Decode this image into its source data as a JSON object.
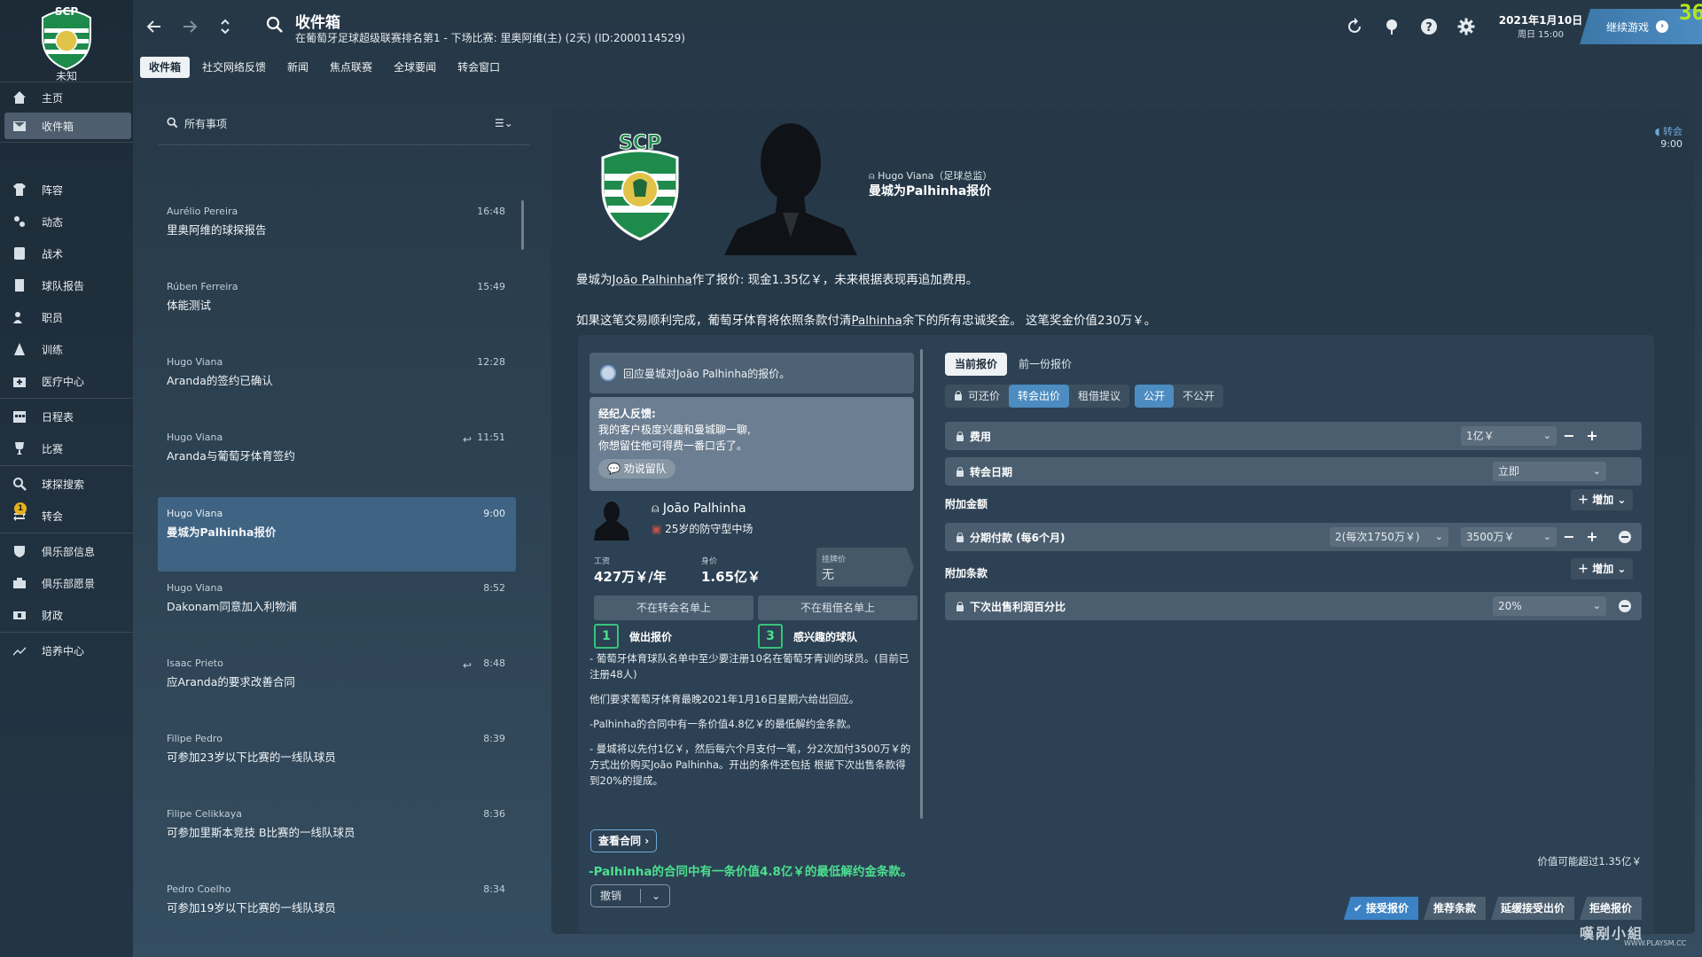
{
  "sidebar": {
    "club_name": "未知",
    "items": [
      {
        "label": "主页",
        "icon": "home-icon"
      },
      {
        "label": "收件箱",
        "icon": "inbox-icon",
        "active": true
      },
      {
        "label": "阵容",
        "icon": "shirt-icon"
      },
      {
        "label": "动态",
        "icon": "dynamics-icon"
      },
      {
        "label": "战术",
        "icon": "tactics-icon"
      },
      {
        "label": "球队报告",
        "icon": "report-icon"
      },
      {
        "label": "职员",
        "icon": "staff-icon"
      },
      {
        "label": "训练",
        "icon": "training-icon"
      },
      {
        "label": "医疗中心",
        "icon": "medical-icon"
      },
      {
        "label": "日程表",
        "icon": "calendar-icon"
      },
      {
        "label": "比赛",
        "icon": "trophy-icon"
      },
      {
        "label": "球探搜索",
        "icon": "scouting-icon"
      },
      {
        "label": "转会",
        "icon": "transfer-icon",
        "badge": "1"
      },
      {
        "label": "俱乐部信息",
        "icon": "shield-icon"
      },
      {
        "label": "俱乐部愿景",
        "icon": "vision-icon"
      },
      {
        "label": "财政",
        "icon": "finance-icon"
      },
      {
        "label": "培养中心",
        "icon": "development-icon"
      }
    ]
  },
  "header": {
    "title": "收件箱",
    "subtitle": "在葡萄牙足球超级联赛排名第1 - 下场比赛: 里奥阿维(主) (2天) (ID:2000114529)",
    "tabs": [
      "收件箱",
      "社交网络反馈",
      "新闻",
      "焦点联赛",
      "全球要闻",
      "转会窗口"
    ],
    "date_line1": "2021年1月10日",
    "date_line2": "周日 15:00",
    "continue_label": "继续游戏",
    "fps": "36"
  },
  "inbox": {
    "search_label": "所有事项",
    "messages": [
      {
        "sender": "Aurélio Pereira",
        "subject": "里奥阿维的球探报告",
        "time": "16:48"
      },
      {
        "sender": "Rúben Ferreira",
        "subject": "体能测试",
        "time": "15:49"
      },
      {
        "sender": "Hugo Viana",
        "subject": "Aranda的签约已确认",
        "time": "12:28"
      },
      {
        "sender": "Hugo Viana",
        "subject": "Aranda与葡萄牙体育签约",
        "time": "11:51",
        "replied": true
      },
      {
        "sender": "Hugo Viana",
        "subject": "曼城为Palhinha报价",
        "time": "9:00",
        "active": true
      },
      {
        "sender": "Hugo Viana",
        "subject": "Dakonam同意加入利物浦",
        "time": "8:52"
      },
      {
        "sender": "Isaac Prieto",
        "subject": "应Aranda的要求改善合同",
        "time": "8:48",
        "replied": true
      },
      {
        "sender": "Filipe Pedro",
        "subject": "可参加23岁以下比赛的一线队球员",
        "time": "8:39"
      },
      {
        "sender": "Filipe Celikkaya",
        "subject": "可参加里斯本竞技 B比赛的一线队球员",
        "time": "8:36"
      },
      {
        "sender": "Pedro Coelho",
        "subject": "可参加19岁以下比赛的一线队球员",
        "time": "8:34"
      }
    ]
  },
  "message": {
    "from": "Hugo Viana（足球总监）",
    "title": "曼城为Palhinha报价",
    "corner_tag": "转会",
    "corner_time": "9:00",
    "para1": {
      "a": "曼城为",
      "link": "João Palhinha",
      "b": "作了报价: 现金1.35亿￥，未来根据表现再追加费用。"
    },
    "para2": {
      "a": "如果这笔交易顺利完成，葡萄牙体育将依照条款付清",
      "link": "Palhinha",
      "b": "余下的所有忠诚奖金。 这笔奖金价值230万￥。"
    }
  },
  "deal": {
    "respond_label": "回应曼城对João Palhinha的报价。",
    "agent_label": "经纪人反馈:",
    "agent_line1": "我的客户极度兴趣和曼城聊一聊,",
    "agent_line2": "你想留住他可得费一番口舌了。",
    "persuade_label": "劝说留队",
    "player": {
      "name": "João Palhinha",
      "desc": "25岁的防守型中场",
      "wage_label": "工资",
      "wage": "427万￥/年",
      "value_label": "身价",
      "value": "1.65亿￥",
      "asking_label": "挂牌价",
      "asking": "无"
    },
    "not_transfer_list": "不在转会名单上",
    "not_loan_list": "不在租借名单上",
    "offers_count": "1",
    "offers_label": "做出报价",
    "interested_count": "3",
    "interested_label": "感兴趣的球队",
    "notes": [
      "- 葡萄牙体育球队名单中至少要注册10名在葡萄牙青训的球员。(目前已注册48人)",
      "他们要求葡萄牙体育最晚2021年1月16日星期六给出回应。",
      "-Palhinha的合同中有一条价值4.8亿￥的最低解约金条款。",
      "- 曼城将以先付1亿￥，然后每六个月支付一笔，分2次加付3500万￥的方式出价购买João Palhinha。开出的条件还包括 根据下次出售条款得到20%的提成。"
    ],
    "view_contract": "查看合同",
    "release_note": "-Palhinha的合同中有一条价值4.8亿￥的最低解约金条款。",
    "undo_label": "撤销",
    "offer_tabs": [
      "当前报价",
      "前一份报价"
    ],
    "type_toggles": [
      "可还价",
      "转会出价",
      "租借提议"
    ],
    "visibility_toggles": [
      "公开",
      "不公开"
    ],
    "fee_label": "费用",
    "fee_value": "1亿￥",
    "date_label": "转会日期",
    "date_value": "立即",
    "addons_label": "附加金额",
    "add_label": "增加",
    "installments_label": "分期付款 (每6个月)",
    "installments_count": "2(每次1750万￥)",
    "installments_value": "3500万￥",
    "clauses_label": "附加条款",
    "sell_on_label": "下次出售利润百分比",
    "sell_on_value": "20%",
    "value_note": "价值可能超过1.35亿￥",
    "actions": [
      "接受报价",
      "推荐条款",
      "延缓接受出价",
      "拒绝报价"
    ]
  },
  "watermark": {
    "text": "嘆剐小組",
    "sub": "WWW.PLAYSM.CC"
  }
}
